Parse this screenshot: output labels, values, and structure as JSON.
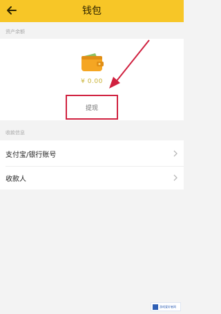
{
  "header": {
    "title": "钱包",
    "back_icon": "arrow-left-icon",
    "background": "#f7c627"
  },
  "wallet": {
    "section_label": "资产余额",
    "icon": "wallet-icon",
    "balance": "¥ 0.00",
    "withdraw_label": "提现"
  },
  "payment": {
    "section_label": "收款信息",
    "items": [
      {
        "label": "支付宝/银行账号",
        "icon": "chevron-right-icon"
      },
      {
        "label": "收款人",
        "icon": "chevron-right-icon"
      }
    ]
  },
  "watermark": {
    "text": "游戏爱好者网"
  },
  "colors": {
    "accent": "#f7c627",
    "highlight_box": "#d0213f",
    "balance": "#c8b234"
  }
}
